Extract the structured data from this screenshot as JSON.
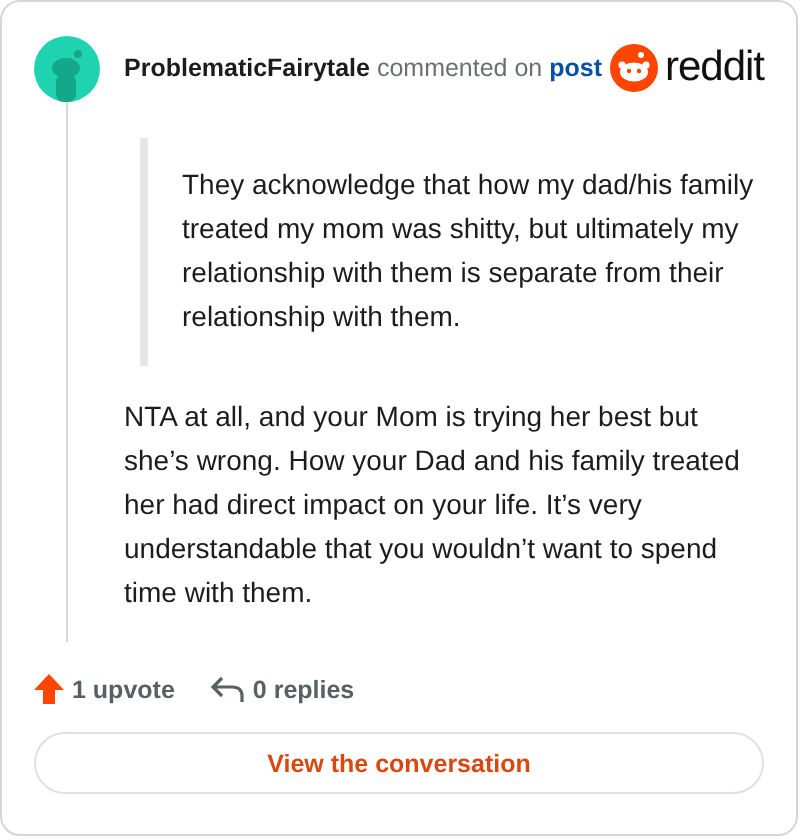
{
  "header": {
    "author": "ProblematicFairytale",
    "action": "commented on",
    "link": "post",
    "brand": "reddit"
  },
  "quote": "They acknowledge that how my dad/his family treated my mom was shitty, but ultimately my relationship with them is separate from their relationship with them.",
  "body": "NTA at all, and your Mom is trying her best but she’s wrong. How your Dad and his family treated her had direct impact on your life. It’s very understandable that you wouldn’t want to spend time with them.",
  "footer": {
    "upvotes": "1 upvote",
    "replies": "0 replies"
  },
  "button": "View the conversation"
}
